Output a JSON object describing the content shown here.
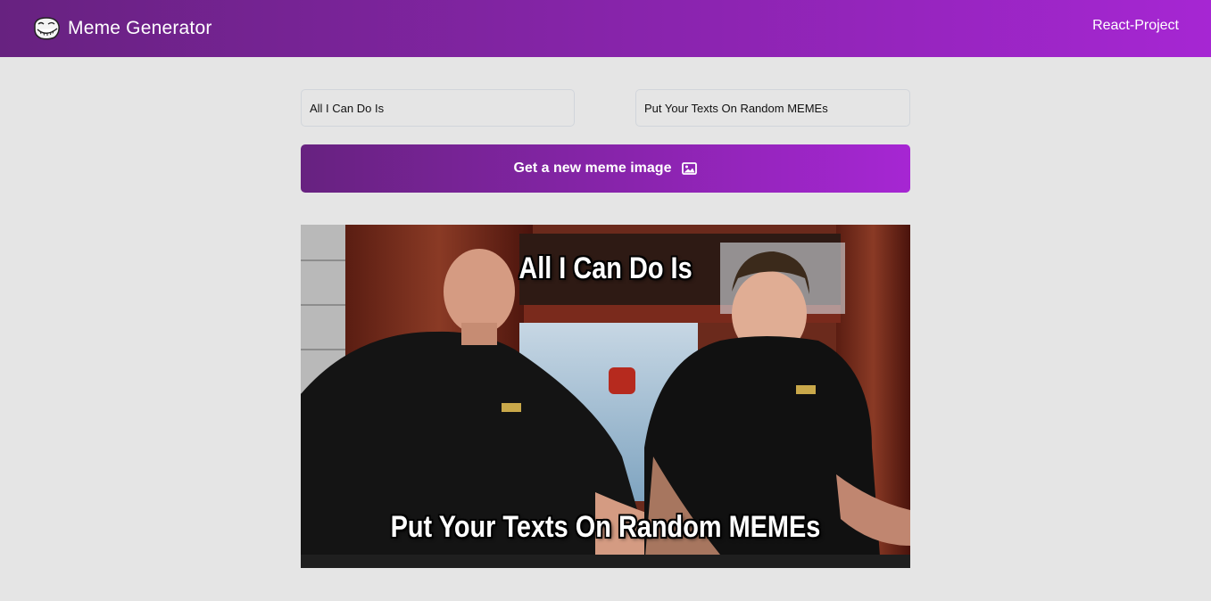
{
  "header": {
    "title": "Meme Generator",
    "project_label": "React-Project",
    "logo_icon": "troll-face-icon"
  },
  "form": {
    "top_text_value": "All I Can Do Is",
    "bottom_text_value": "Put Your Texts On Random MEMEs",
    "button_label": "Get a new meme image",
    "button_icon": "image-icon"
  },
  "meme": {
    "top_text": "All I Can Do Is",
    "bottom_text": "Put Your Texts On Random MEMEs"
  },
  "colors": {
    "gradient_start": "#672280",
    "gradient_end": "#a626d3",
    "background": "#e5e5e5"
  }
}
